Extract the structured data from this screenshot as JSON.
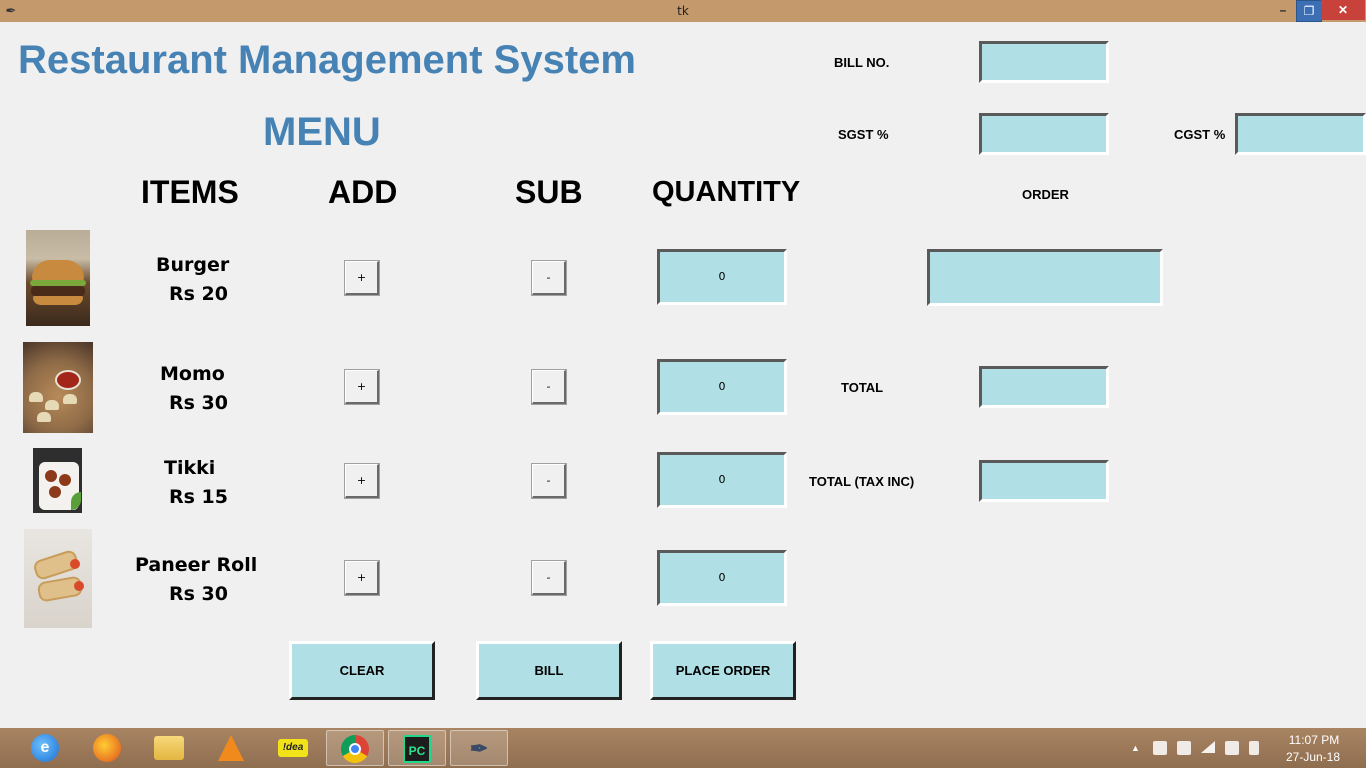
{
  "window": {
    "title": "tk",
    "icon": "feather-icon",
    "min_label": "–",
    "max_label": "❐",
    "close_label": "✕"
  },
  "header": {
    "app_title": "Restaurant Management System",
    "menu_title": "MENU"
  },
  "columns": {
    "items": "ITEMS",
    "add": "ADD",
    "sub": "SUB",
    "quantity": "QUANTITY"
  },
  "items": [
    {
      "name": "Burger",
      "price": "Rs 20",
      "image_icon": "burger-image",
      "add_label": "+",
      "sub_label": "-",
      "quantity": "0"
    },
    {
      "name": "Momo",
      "price": "Rs 30",
      "image_icon": "momo-image",
      "add_label": "+",
      "sub_label": "-",
      "quantity": "0"
    },
    {
      "name": "Tikki",
      "price": "Rs 15",
      "image_icon": "tikki-image",
      "add_label": "+",
      "sub_label": "-",
      "quantity": "0"
    },
    {
      "name": "Paneer Roll",
      "price": "Rs 30",
      "image_icon": "paneer-roll-image",
      "add_label": "+",
      "sub_label": "-",
      "quantity": "0"
    }
  ],
  "billing": {
    "bill_no_label": "BILL NO.",
    "bill_no_value": "",
    "sgst_label": "SGST %",
    "sgst_value": "",
    "cgst_label": "CGST %",
    "cgst_value": "",
    "order_label": "ORDER",
    "order_value": "",
    "total_label": "TOTAL",
    "total_value": "",
    "total_tax_label": "TOTAL (TAX INC)",
    "total_tax_value": ""
  },
  "actions": {
    "clear": "CLEAR",
    "bill": "BILL",
    "place_order": "PLACE ORDER"
  },
  "colors": {
    "title": "#4682b4",
    "entry_bg": "#b0e0e6",
    "window_bg": "#f0f0f0",
    "titlebar_bg": "#c49a6c"
  },
  "taskbar": {
    "apps": [
      "internet-explorer-icon",
      "firefox-icon",
      "file-explorer-icon",
      "vlc-icon",
      "idea-icon",
      "chrome-icon",
      "pycharm-icon",
      "tk-feather-icon"
    ],
    "idea_text": "!dea",
    "pycharm_text": "PC",
    "ie_text": "e",
    "clock_time": "11:07 PM",
    "clock_date": "27-Jun-18"
  }
}
